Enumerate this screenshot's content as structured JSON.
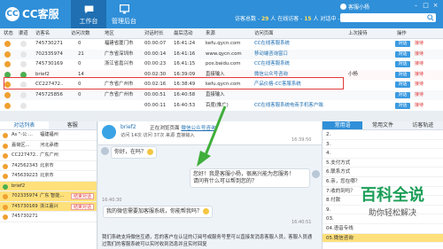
{
  "header": {
    "logo_letters": "CC",
    "logo_text": "CC客服",
    "tabs": [
      {
        "label": "工作台",
        "active": true,
        "icon": "chat-bubble-icon"
      },
      {
        "label": "管理后台",
        "active": false,
        "icon": "monitor-icon"
      }
    ],
    "stats": {
      "visitors_label": "访客总数 -",
      "visitors": "29",
      "in_chat_label": "人 在线访客 -",
      "in_chat": "15",
      "chatting_label": "人 对话中 -",
      "chatting": "7",
      "suffix": "人"
    },
    "user": "客服小杨",
    "search_placeholder": "",
    "accent": "#2f8fd8"
  },
  "table": {
    "columns": [
      "状态",
      "渠道",
      "访客名",
      "访问次数",
      "地区",
      "对话时长",
      "最后活动",
      "来源",
      "访问页面",
      "上次接待",
      "操作"
    ],
    "rows": [
      {
        "status_color": "#f0a030",
        "id": "745730271",
        "visits": "0",
        "region": "福建省厦门市",
        "duration": "00:00:07",
        "last": "16:41:24",
        "source": "kefu.qycn.com",
        "page": "CC在线客服系统",
        "prev": "",
        "action": "对话 接待"
      },
      {
        "status_color": "#f0a030",
        "id": "702335974",
        "visits": "21",
        "region": "广东省深圳市",
        "duration": "00:00:14",
        "last": "16:41:16",
        "source": "www.qycn.com",
        "page": "移动端咨询窗口",
        "prev": "",
        "action": "对话 接待"
      },
      {
        "status_color": "#f0a030",
        "id": "745730169",
        "visits": "0",
        "region": "浙江省嘉兴市",
        "duration": "00:00:23",
        "last": "16:41:15",
        "source": "pos.baidu.com",
        "page": "CC在线客服系统",
        "prev": "",
        "action": "对话 接待"
      },
      {
        "status_color": "#4caf50",
        "id": "brief2",
        "visits": "14",
        "region": "",
        "duration": "00:02:30",
        "last": "16:39:09",
        "source": "直接输入",
        "page": "微信公众号咨询",
        "prev": "小杨",
        "action": "对话 接待"
      },
      {
        "status_color": "#f0a030",
        "id": "CC227472..",
        "visits": "0",
        "region": "广东省广州市",
        "duration": "00:02:16",
        "last": "16:38:49",
        "source": "kefu.qycn.com",
        "page": "产品价格-CC客服系统",
        "prev": "",
        "action": "对话 接待"
      },
      {
        "status_color": "#f0a030",
        "id": "745725856",
        "visits": "0",
        "region": "广东省广州市",
        "duration": "00:00:51",
        "last": "16:40:58",
        "source": "直接输入",
        "page": "",
        "prev": "",
        "action": "对话 接待"
      },
      {
        "status_color": "#f0a030",
        "id": "",
        "visits": "",
        "region": "",
        "duration": "00:00:11",
        "last": "16:40:53",
        "source": "百度(推广)",
        "page": "CC在线客服系统电商手机客户端",
        "prev": "",
        "action": "对话 接待"
      }
    ]
  },
  "left_panel": {
    "tabs": [
      "对话列表",
      "客服"
    ],
    "items": [
      {
        "dot": "#f0a030",
        "name": "As \"-公 ...",
        "loc": "福建福州",
        "btn": "",
        "hl": false
      },
      {
        "dot": "#f0a030",
        "name": "嘉荷区...",
        "loc": "河北承德",
        "btn": "",
        "hl": false
      },
      {
        "dot": "#f0a030",
        "name": "CC227472..",
        "loc": "广东广州",
        "btn": "",
        "hl": false
      },
      {
        "dot": "#f0a030",
        "name": "742562343",
        "loc": "北京市",
        "btn": "",
        "hl": false
      },
      {
        "dot": "#f0a030",
        "name": "745639223",
        "loc": "北京市",
        "btn": "",
        "hl": false
      },
      {
        "dot": "#4caf50",
        "name": "brief2",
        "loc": "",
        "btn": "",
        "hl": true
      },
      {
        "dot": "#f0a030",
        "name": "702335974",
        "loc": "广东 智能...",
        "btn": "结束对话",
        "hl": true
      },
      {
        "dot": "#f0a030",
        "name": "745730169",
        "loc": "浙江嘉兴",
        "btn": "结束对话",
        "hl": true
      },
      {
        "dot": "#f0a030",
        "name": "745730271",
        "loc": "",
        "btn": "",
        "hl": false
      }
    ]
  },
  "chat": {
    "name": "brief2",
    "browsing_label": "正在浏览页面",
    "browsing_page": "微信公众号咨询",
    "meta": "访问 14次 访问 37次 来源 直接输入",
    "msg1": "你好，在吗？",
    "time1": "16:39:50",
    "msg2_line1": "您好！我是客服小杨，很高兴能为您服务！",
    "msg2_line2": "请问有什么可以帮到您的？",
    "time2": "16:40:30",
    "msg3": "我的微信需要加客服系统，你能帮我吗？",
    "time3": "16:40:51",
    "sys_text": "我们系统支持微信互通，您的客户在认证的订阅号或服务号里可以直接发消息客服人员，客服人员通过我们的客服系统可以实时收到消息并且实时回复"
  },
  "right_panel": {
    "tabs": [
      "常用语",
      "常用文件",
      "访客轨迹"
    ],
    "items": [
      {
        "text": "2.",
        "hl": false
      },
      {
        "text": "3.",
        "hl": false
      },
      {
        "text": "4.",
        "hl": false
      },
      {
        "text": "5.支付方式",
        "hl": false
      },
      {
        "text": "6.联系方式",
        "hl": false
      },
      {
        "text": "6.亲，您在哪？",
        "hl": false
      },
      {
        "text": "7.收的到吗？",
        "hl": false
      },
      {
        "text": "8.付款",
        "hl": false
      },
      {
        "text": "9.",
        "hl": false
      },
      {
        "text": "03.",
        "hl": false
      },
      {
        "text": "04.语音专线",
        "hl": false
      },
      {
        "text": "05.微信咨询",
        "hl": true
      }
    ]
  },
  "watermark": {
    "title": "百科全说",
    "subtitle": "助你轻松解决"
  }
}
